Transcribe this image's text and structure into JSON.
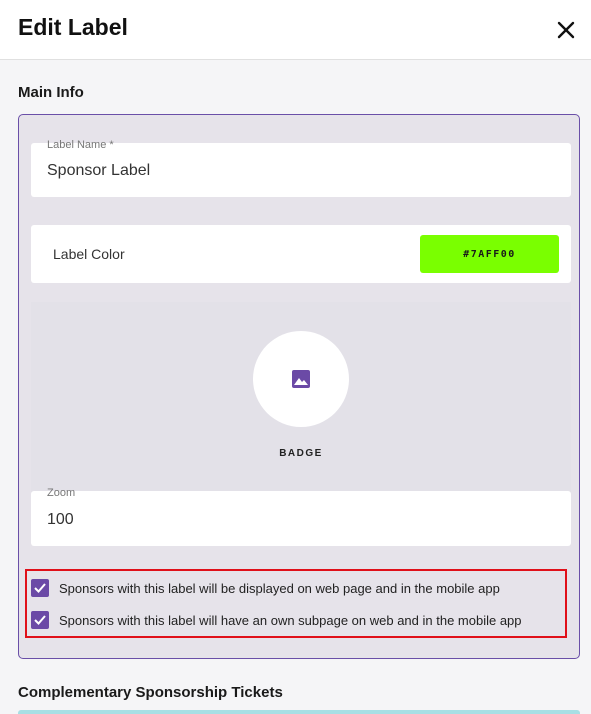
{
  "header": {
    "title": "Edit Label",
    "close_icon": "close-icon"
  },
  "sections": {
    "main_info": "Main Info",
    "complementary": "Complementary Sponsorship Tickets"
  },
  "form": {
    "label_name": {
      "label": "Label Name *",
      "value": "Sponsor Label"
    },
    "label_color": {
      "label": "Label Color",
      "value": "#7AFF00",
      "swatch": "#7aff00"
    },
    "badge": {
      "label": "BADGE",
      "icon": "image-icon",
      "icon_color": "#6b4aa6"
    },
    "zoom": {
      "label": "Zoom",
      "value": "100"
    },
    "checkboxes": [
      {
        "label": "Sponsors with this label will be displayed on web page and in the mobile app",
        "checked": true
      },
      {
        "label": "Sponsors with this label will have an own subpage on web and in the mobile app",
        "checked": true
      }
    ]
  },
  "colors": {
    "accent": "#6b4aa6",
    "highlight": "#e0101a"
  }
}
